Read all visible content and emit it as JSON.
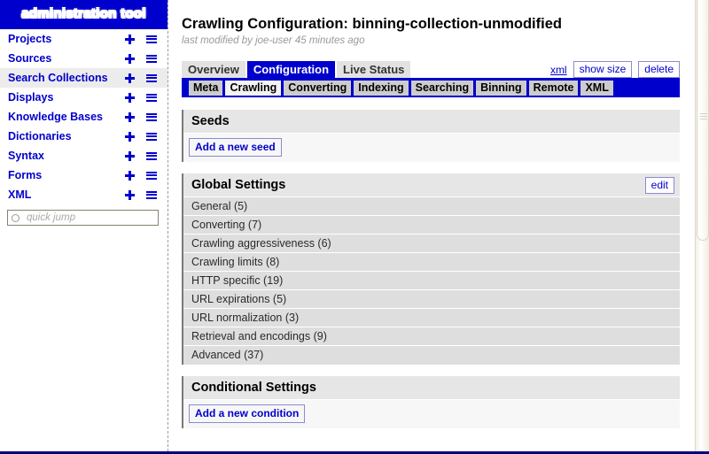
{
  "sidebar": {
    "brand": "administration tool",
    "items": [
      {
        "label": "Projects",
        "selected": false,
        "add_icon": "plus-icon",
        "menu_icon": "hamburger-icon"
      },
      {
        "label": "Sources",
        "selected": false,
        "add_icon": "plus-icon",
        "menu_icon": "hamburger-icon"
      },
      {
        "label": "Search Collections",
        "selected": true,
        "add_icon": "plus-icon",
        "menu_icon": "hamburger-icon"
      },
      {
        "label": "Displays",
        "selected": false,
        "add_icon": "plus-icon",
        "menu_icon": "hamburger-icon"
      },
      {
        "label": "Knowledge Bases",
        "selected": false,
        "add_icon": "plus-icon",
        "menu_icon": "hamburger-icon"
      },
      {
        "label": "Dictionaries",
        "selected": false,
        "add_icon": "plus-icon",
        "menu_icon": "hamburger-icon"
      },
      {
        "label": "Syntax",
        "selected": false,
        "add_icon": "plus-icon",
        "menu_icon": "hamburger-icon"
      },
      {
        "label": "Forms",
        "selected": false,
        "add_icon": "plus-icon",
        "menu_icon": "hamburger-icon"
      },
      {
        "label": "XML",
        "selected": false,
        "add_icon": "plus-icon",
        "menu_icon": "hamburger-icon"
      }
    ],
    "quick_jump": {
      "placeholder": "quick jump",
      "value": "",
      "icon": "circle-icon"
    }
  },
  "header": {
    "title": "Crawling Configuration: binning-collection-unmodified",
    "subtitle": "last modified by joe-user 45 minutes ago"
  },
  "tabs": {
    "items": [
      {
        "label": "Overview",
        "active": false
      },
      {
        "label": "Configuration",
        "active": true
      },
      {
        "label": "Live Status",
        "active": false
      }
    ],
    "actions": {
      "xml_link": "xml",
      "show_size": "show size",
      "delete": "delete"
    }
  },
  "subtabs": {
    "items": [
      {
        "label": "Meta",
        "active": false
      },
      {
        "label": "Crawling",
        "active": true
      },
      {
        "label": "Converting",
        "active": false
      },
      {
        "label": "Indexing",
        "active": false
      },
      {
        "label": "Searching",
        "active": false
      },
      {
        "label": "Binning",
        "active": false
      },
      {
        "label": "Remote",
        "active": false
      },
      {
        "label": "XML",
        "active": false
      }
    ]
  },
  "panels": {
    "seeds": {
      "title": "Seeds",
      "add_button": "Add a new seed"
    },
    "global_settings": {
      "title": "Global Settings",
      "edit_button": "edit",
      "items": [
        "General (5)",
        "Converting (7)",
        "Crawling aggressiveness (6)",
        "Crawling limits (8)",
        "HTTP specific (19)",
        "URL expirations (5)",
        "URL normalization (3)",
        "Retrieval and encodings (9)",
        "Advanced (37)"
      ]
    },
    "conditional_settings": {
      "title": "Conditional Settings",
      "add_button": "Add a new condition"
    }
  },
  "colors": {
    "brand_blue": "#0000cc",
    "selected_row": "#ececec",
    "settings_row": "#dedede",
    "panel_head": "#e6e6e6"
  }
}
